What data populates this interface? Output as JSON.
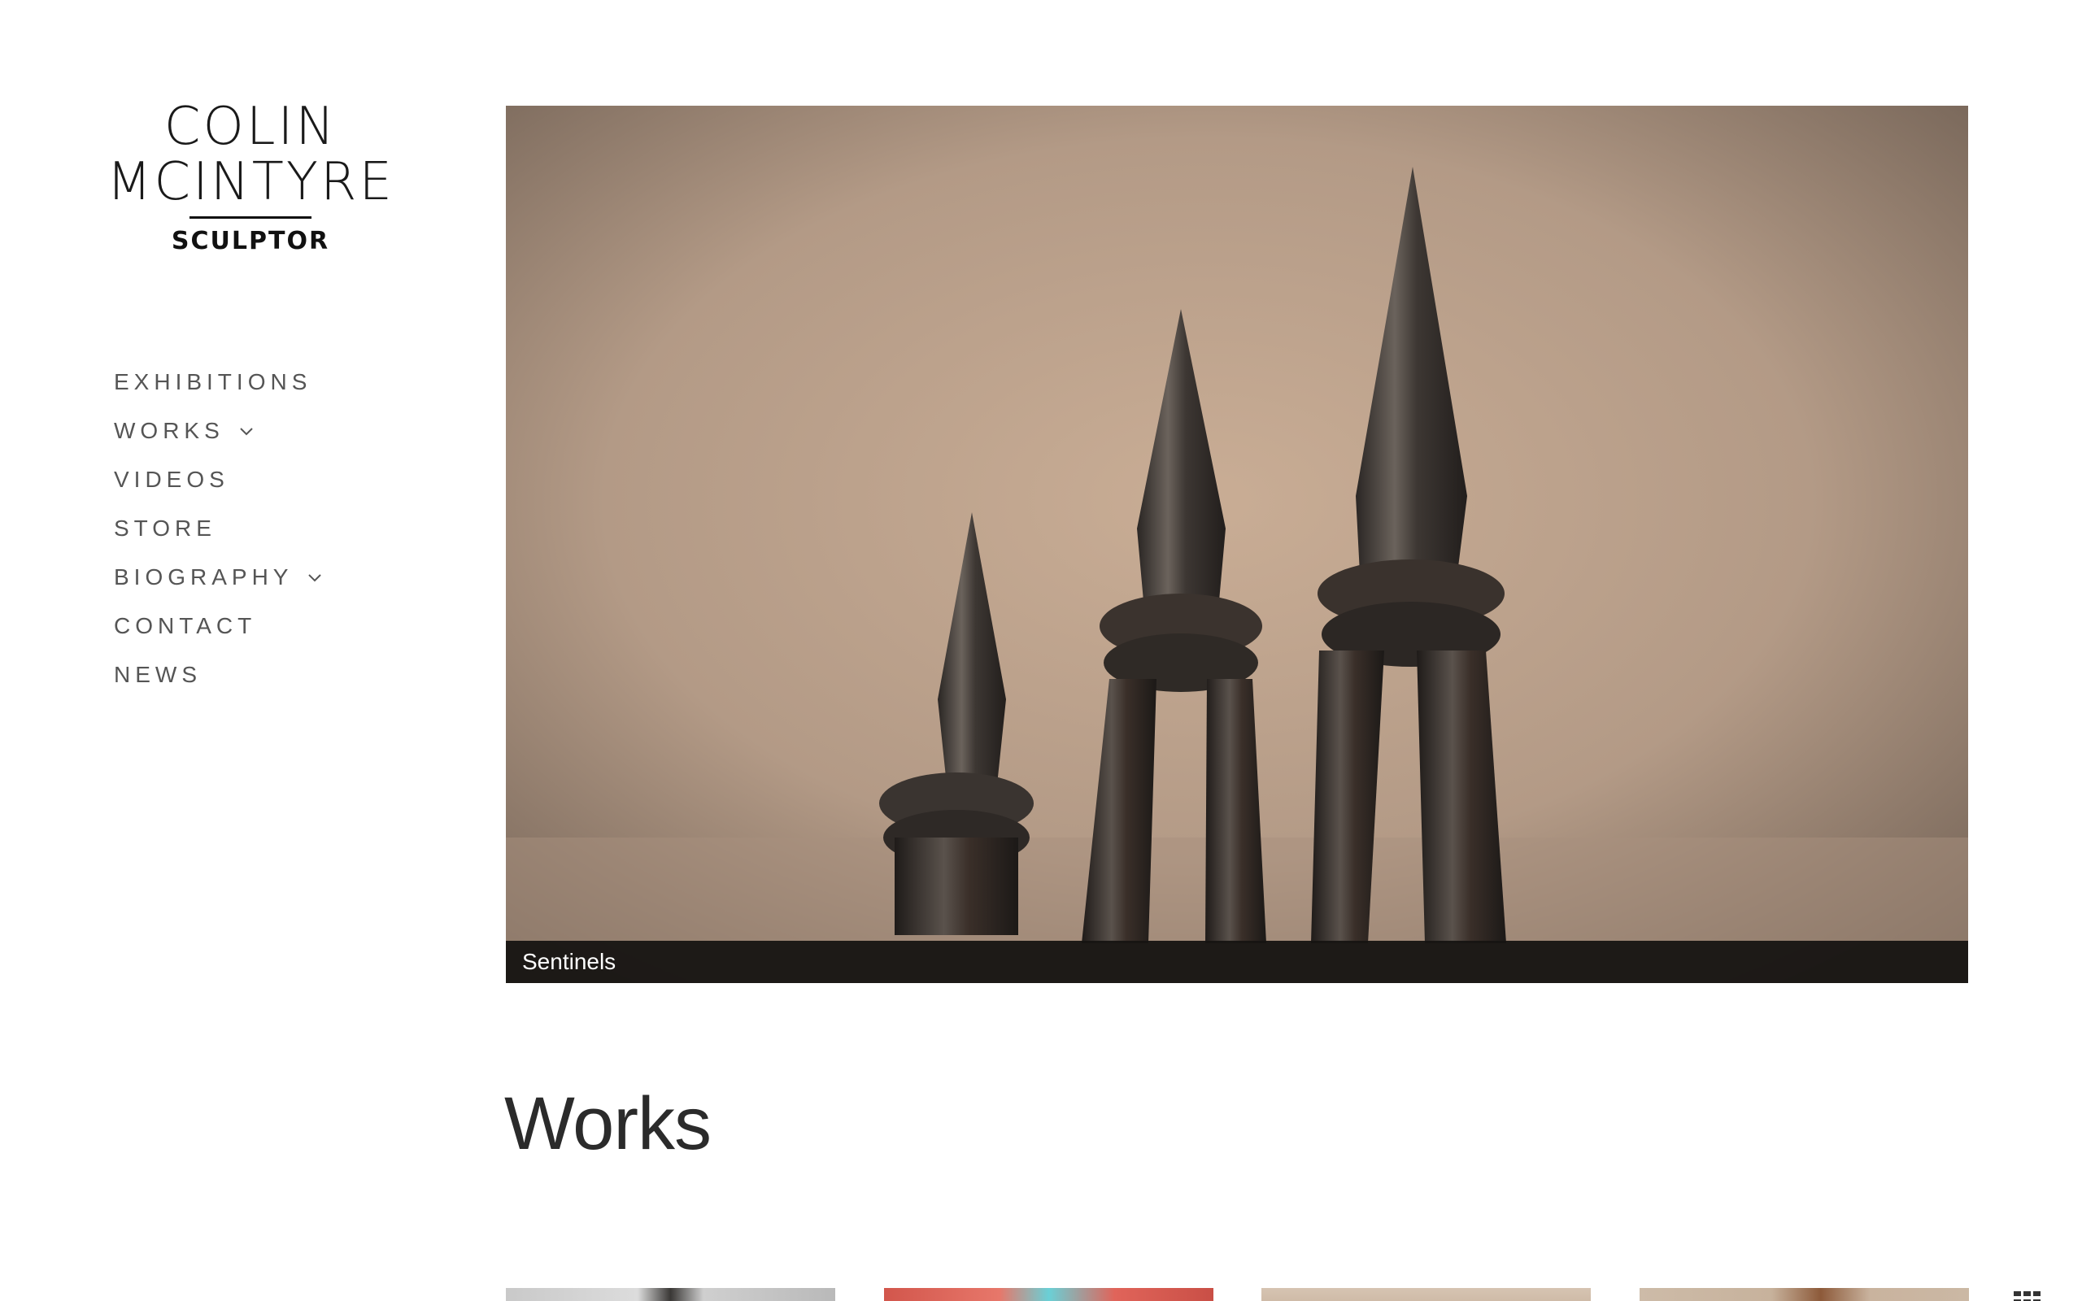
{
  "site": {
    "logo": {
      "line1": "COLIN",
      "line2": "MCINTYRE",
      "subtitle": "SCULPTOR"
    }
  },
  "nav": {
    "items": [
      {
        "label": "EXHIBITIONS",
        "has_dropdown": false
      },
      {
        "label": "WORKS",
        "has_dropdown": true
      },
      {
        "label": "VIDEOS",
        "has_dropdown": false
      },
      {
        "label": "STORE",
        "has_dropdown": false
      },
      {
        "label": "BIOGRAPHY",
        "has_dropdown": true
      },
      {
        "label": "CONTACT",
        "has_dropdown": false
      },
      {
        "label": "NEWS",
        "has_dropdown": false
      }
    ]
  },
  "hero": {
    "caption": "Sentinels",
    "image_alt": "Three dark metal sculptures with pointed spires against a beige backdrop"
  },
  "main": {
    "section_title": "Works"
  },
  "thumbnails": [
    {
      "name": "work-thumb-1"
    },
    {
      "name": "work-thumb-2"
    },
    {
      "name": "work-thumb-3"
    },
    {
      "name": "work-thumb-4"
    }
  ],
  "icons": {
    "grid_view": "grid-icon",
    "chevron": "chevron-down-icon"
  },
  "colors": {
    "nav_text": "#555555",
    "heading_text": "#2b2b2b",
    "caption_bg": "#161412",
    "backdrop": "#b8a08c"
  }
}
